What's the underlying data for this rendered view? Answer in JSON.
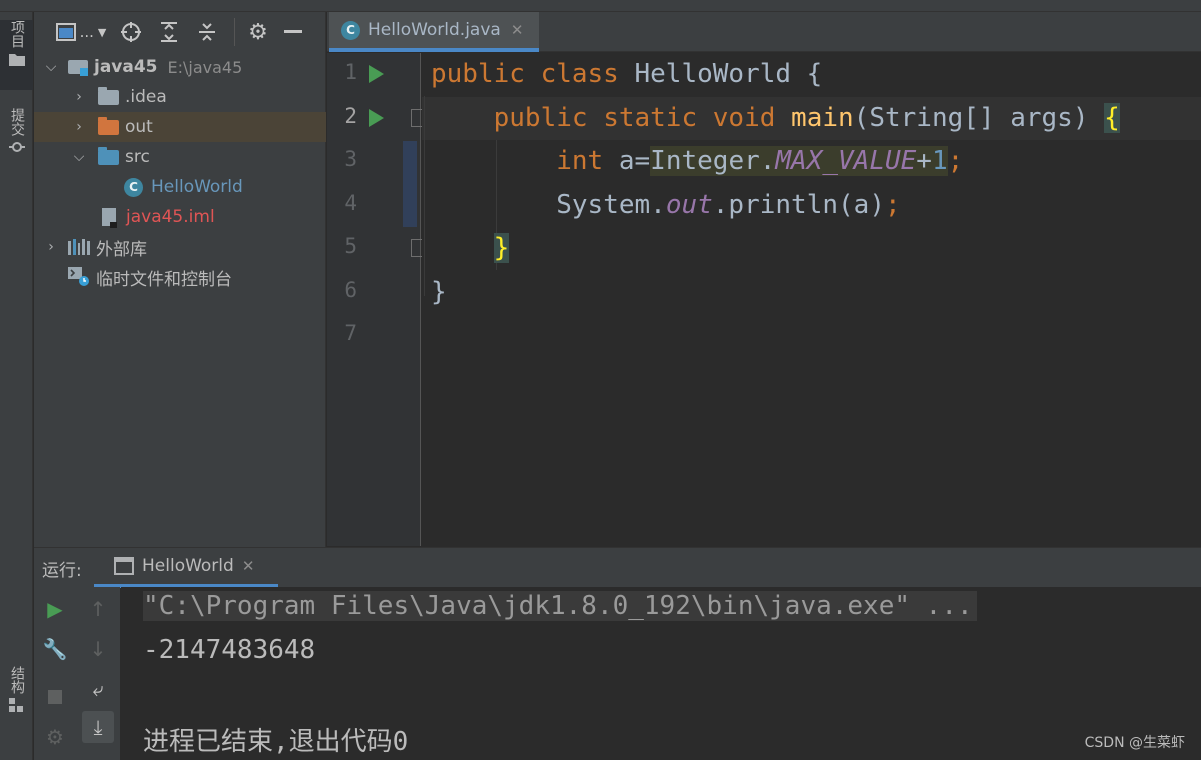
{
  "left_strip": {
    "project_tab": "项目",
    "commit_tab": "提交",
    "structure_tab": "结构"
  },
  "project_panel": {
    "toolbar": {
      "view_label": "..."
    },
    "tree": [
      {
        "label": "java45",
        "path": "E:\\java45"
      },
      {
        "label": ".idea"
      },
      {
        "label": "out"
      },
      {
        "label": "src"
      },
      {
        "label": "HelloWorld"
      },
      {
        "label": "java45.iml"
      },
      {
        "label": "外部库"
      },
      {
        "label": "临时文件和控制台"
      }
    ]
  },
  "editor": {
    "tab_label": "HelloWorld.java",
    "line_numbers": [
      "1",
      "2",
      "3",
      "4",
      "5",
      "6",
      "7"
    ],
    "code": {
      "l1_kw": "public class ",
      "l1_name": "HelloWorld {",
      "l2_kw": "public static void ",
      "l2_fn": "main",
      "l2_rest": "(String[] args) ",
      "l2_brace": "{",
      "l3_kw": "int",
      "l3_a": " a=",
      "l3_cls": "Integer.",
      "l3_const": "MAX_VALUE",
      "l3_plus": "+",
      "l3_num": "1",
      "l3_semi": ";",
      "l4_sys": "System.",
      "l4_out": "out",
      "l4_rest": ".println(a)",
      "l4_semi": ";",
      "l5_brace": "}",
      "l6_brace": "}"
    }
  },
  "run_panel": {
    "label": "运行:",
    "tab_label": "HelloWorld",
    "console": {
      "command": "\"C:\\Program Files\\Java\\jdk1.8.0_192\\bin\\java.exe\" ...",
      "output": "-2147483648",
      "exit_message": "进程已结束,退出代码0"
    }
  },
  "watermark": "CSDN @生菜虾",
  "colors": {
    "keyword": "#cc7832",
    "function": "#ffc66d",
    "number": "#6897bb",
    "constant": "#9876aa",
    "accent": "#4a88c7",
    "run_green": "#499c54"
  }
}
